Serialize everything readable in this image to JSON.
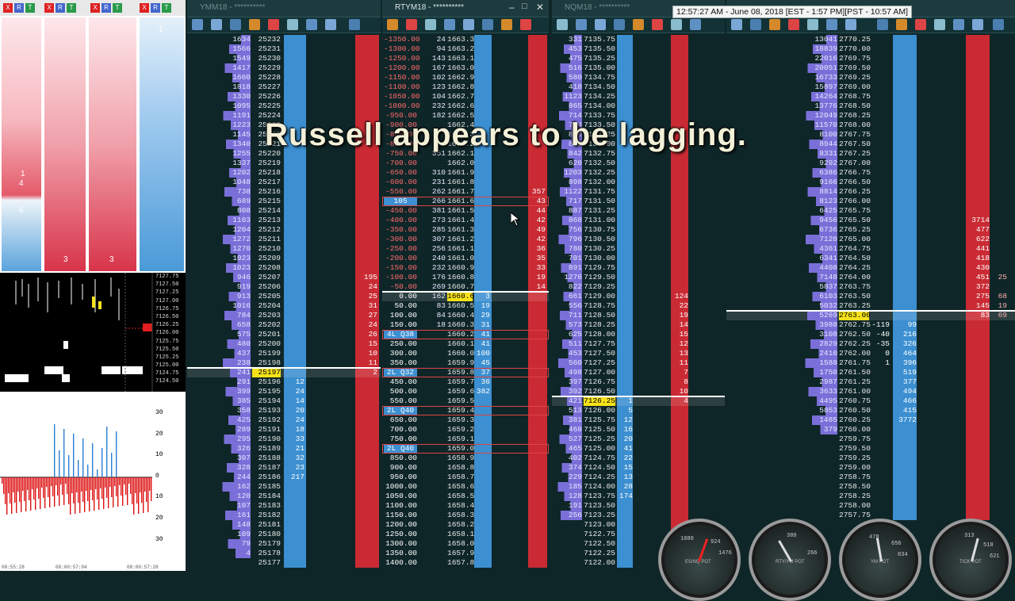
{
  "windows": {
    "ym_title": "YMM18 - **********",
    "rty_title": "RTYM18 - **********",
    "nq_title": "NQM18 - **********",
    "es_title": ""
  },
  "clock": "12:57:27 AM - June 08, 2018 [EST - 1:57 PM][PST - 10:57 AM]",
  "overlay": "Russell appears to be lagging.",
  "left": {
    "ladder_labels": [
      "1",
      "4",
      "6",
      "3",
      "3",
      "1"
    ],
    "price_axis": [
      "7127.75",
      "7127.50",
      "7127.25",
      "7127.00",
      "7126.75",
      "7126.50",
      "7126.25",
      "7126.00",
      "7125.75",
      "7125.50",
      "7125.25",
      "7125.00",
      "7124.75",
      "7124.50"
    ],
    "hist_axis": [
      "30",
      "20",
      "10",
      "0",
      "10",
      "20",
      "30"
    ],
    "time_axis": [
      "08:55:28",
      "08:00:57:04",
      "08:00:57:28"
    ],
    "top_btn_labels": [
      "X",
      "R",
      "T",
      "X",
      "R",
      "T",
      "X",
      "R",
      "T",
      "X",
      "R",
      "T"
    ]
  },
  "ym": {
    "vol": [
      "1634",
      "1566",
      "1549",
      "1417",
      "1660",
      "1818",
      "1330",
      "1095",
      "1191",
      "1223",
      "1145",
      "1340",
      "1255",
      "1337",
      "1202",
      "1048",
      "738",
      "689",
      "808",
      "1103",
      "1204",
      "1272",
      "1270",
      "1023",
      "1023",
      "946",
      "919",
      "913",
      "1016",
      "784",
      "658",
      "575",
      "480",
      "437",
      "238",
      "241",
      "291",
      "399",
      "385",
      "358",
      "425",
      "289",
      "295",
      "326",
      "307",
      "328",
      "244",
      "162",
      "120",
      "107",
      "161",
      "148",
      "109",
      "79",
      "4",
      ""
    ],
    "price": [
      "25232",
      "25231",
      "25230",
      "25229",
      "25228",
      "25227",
      "25226",
      "25225",
      "25224",
      "25223",
      "25222",
      "25221",
      "25220",
      "25219",
      "25218",
      "25217",
      "25216",
      "25215",
      "25214",
      "25213",
      "25212",
      "25211",
      "25210",
      "25209",
      "25208",
      "25207",
      "25206",
      "25205",
      "25204",
      "25203",
      "25202",
      "25201",
      "25200",
      "25199",
      "25198",
      "25197",
      "25196",
      "25195",
      "25194",
      "25193",
      "25192",
      "25191",
      "25190",
      "25189",
      "25188",
      "25187",
      "25186",
      "25185",
      "25184",
      "25183",
      "25182",
      "25181",
      "25180",
      "25179",
      "25178",
      "25177"
    ],
    "bid": {
      "36": "12",
      "37": "24",
      "38": "14",
      "39": "20",
      "40": "24",
      "41": "18",
      "42": "33",
      "43": "21",
      "44": "32",
      "45": "23",
      "46": "217"
    },
    "ask": {
      "25": "195",
      "26": "24",
      "27": "25",
      "28": "31",
      "29": "27",
      "30": "24",
      "31": "26",
      "32": "15",
      "33": "10",
      "34": "11",
      "35": "2"
    },
    "last_index": 35,
    "side_nums": {
      "4": "4",
      "10": "10",
      "1": "1",
      "5": "5"
    }
  },
  "rty": {
    "offset": [
      "-1350.00",
      "-1300.00",
      "-1250.00",
      "-1200.00",
      "-1150.00",
      "-1100.00",
      "-1050.00",
      "-1000.00",
      "-950.00",
      "-900.00",
      "-850.00",
      "-800.00",
      "-750.00",
      "-700.00",
      "-650.00",
      "-600.00",
      "-550.00",
      "-500.00",
      "-450.00",
      "-400.00",
      "-350.00",
      "-300.00",
      "-250.00",
      "-200.00",
      "-150.00",
      "-100.00",
      "-50.00",
      "0.00",
      "50.00",
      "100.00",
      "150.00",
      "200.00",
      "250.00",
      "300.00",
      "350.00",
      "400.00",
      "450.00",
      "500.00",
      "550.00",
      "600.00",
      "650.00",
      "700.00",
      "750.00",
      "800.00",
      "850.00",
      "900.00",
      "950.00",
      "1000.00",
      "1050.00",
      "1100.00",
      "1150.00",
      "1200.00",
      "1250.00",
      "1300.00",
      "1350.00",
      "1400.00"
    ],
    "vol": [
      "24",
      "94",
      "143",
      "167",
      "102",
      "123",
      "104",
      "232",
      "182",
      "",
      "",
      "",
      "351",
      "",
      "310",
      "231",
      "262",
      "266",
      "381",
      "273",
      "285",
      "307",
      "256",
      "240",
      "232",
      "176",
      "269",
      "162",
      "83",
      "84",
      "18",
      "",
      "",
      "",
      "",
      "",
      "",
      "",
      "",
      "",
      "",
      "",
      "",
      "",
      "",
      "",
      "",
      "",
      "",
      "",
      "",
      "",
      "",
      "",
      "",
      ""
    ],
    "price": [
      "1663.3",
      "1663.2",
      "1663.1",
      "1663.0",
      "1662.9",
      "1662.8",
      "1662.7",
      "1662.6",
      "1662.5",
      "1662.4",
      "1662.3",
      "1662.2",
      "1662.1",
      "1662.0",
      "1661.9",
      "1661.8",
      "1661.7",
      "1661.6",
      "1661.5",
      "1661.4",
      "1661.3",
      "1661.2",
      "1661.1",
      "1661.0",
      "1660.9",
      "1660.8",
      "1660.7",
      "1660.6",
      "1660.5",
      "1660.4",
      "1660.3",
      "1660.2",
      "1660.1",
      "1660.0",
      "1659.9",
      "1659.8",
      "1659.7",
      "1659.6",
      "1659.5",
      "1659.4",
      "1659.3",
      "1659.2",
      "1659.1",
      "1659.0",
      "1658.9",
      "1658.8",
      "1658.7",
      "1658.6",
      "1658.5",
      "1658.4",
      "1658.3",
      "1658.2",
      "1658.1",
      "1658.0",
      "1657.9",
      "1657.8"
    ],
    "bid": {
      "27": "3",
      "28": "19",
      "29": "29",
      "30": "31",
      "31": "41",
      "32": "41",
      "33": "100",
      "34": "45",
      "35": "37",
      "36": "36",
      "37": "382"
    },
    "ask": {
      "16": "357",
      "17": "43",
      "18": "44",
      "19": "42",
      "20": "49",
      "21": "42",
      "22": "36",
      "23": "35",
      "24": "33",
      "25": "19",
      "26": "14"
    },
    "last_index": 27,
    "tags": {
      "17": "105",
      "31": "4L Q38",
      "35": "2L Q32",
      "39": "2L Q40",
      "43": "2L Q40"
    }
  },
  "nq": {
    "vol": [
      "331",
      "453",
      "475",
      "516",
      "580",
      "418",
      "1123",
      "865",
      "714",
      "734",
      "849",
      "888",
      "842",
      "620",
      "1203",
      "898",
      "1122",
      "717",
      "887",
      "868",
      "756",
      "796",
      "780",
      "701",
      "891",
      "1276",
      "822",
      "661",
      "556",
      "711",
      "573",
      "625",
      "511",
      "453",
      "560",
      "498",
      "397",
      "392",
      "421",
      "513",
      "381",
      "468",
      "527",
      "465",
      "402",
      "374",
      "229",
      "185",
      "128",
      "191",
      "256"
    ],
    "price": [
      "7135.75",
      "7135.50",
      "7135.25",
      "7135.00",
      "7134.75",
      "7134.50",
      "7134.25",
      "7134.00",
      "7133.75",
      "7133.50",
      "7133.25",
      "7133.00",
      "7132.75",
      "7132.50",
      "7132.25",
      "7132.00",
      "7131.75",
      "7131.50",
      "7131.25",
      "7131.00",
      "7130.75",
      "7130.50",
      "7130.25",
      "7130.00",
      "7129.75",
      "7129.50",
      "7129.25",
      "7129.00",
      "7128.75",
      "7128.50",
      "7128.25",
      "7128.00",
      "7127.75",
      "7127.50",
      "7127.25",
      "7127.00",
      "7126.75",
      "7126.50",
      "7126.25",
      "7126.00",
      "7125.75",
      "7125.50",
      "7125.25",
      "7125.00",
      "7124.75",
      "7124.50",
      "7124.25",
      "7124.00",
      "7123.75",
      "7123.50",
      "7123.25",
      "7123.00",
      "7122.75",
      "7122.50",
      "7122.25",
      "7122.00"
    ],
    "bid": {
      "38": "1",
      "39": "5",
      "40": "12",
      "41": "16",
      "42": "20",
      "43": "41",
      "44": "22",
      "45": "15",
      "46": "13",
      "47": "28",
      "48": "174"
    },
    "ask": {
      "27": "124",
      "28": "22",
      "29": "19",
      "30": "14",
      "31": "15",
      "32": "12",
      "33": "13",
      "34": "11",
      "35": "7",
      "36": "8",
      "37": "10",
      "38": "4"
    },
    "last_index": 38,
    "side_nums": {
      "3": "3"
    }
  },
  "es": {
    "vol": [
      "13041",
      "18839",
      "22016",
      "20051",
      "16733",
      "15897",
      "14264",
      "13776",
      "12049",
      "11570",
      "8100",
      "8944",
      "8331",
      "9292",
      "6386",
      "9166",
      "8814",
      "8123",
      "6425",
      "9456",
      "6736",
      "7120",
      "4361",
      "6341",
      "4408",
      "7148",
      "5837",
      "6103",
      "5032",
      "5269",
      "3988",
      "3108",
      "2829",
      "2410",
      "1588",
      "1750",
      "2987",
      "3633",
      "4495",
      "5853",
      "1485",
      "379",
      "",
      "",
      "",
      "",
      "",
      "",
      "",
      "",
      ""
    ],
    "price": [
      "2770.25",
      "2770.00",
      "2769.75",
      "2769.50",
      "2769.25",
      "2769.00",
      "2768.75",
      "2768.50",
      "2768.25",
      "2768.00",
      "2767.75",
      "2767.50",
      "2767.25",
      "2767.00",
      "2766.75",
      "2766.50",
      "2766.25",
      "2766.00",
      "2765.75",
      "2765.50",
      "2765.25",
      "2765.00",
      "2764.75",
      "2764.50",
      "2764.25",
      "2764.00",
      "2763.75",
      "2763.50",
      "2763.25",
      "2763.00",
      "2762.75",
      "2762.50",
      "2762.25",
      "2762.00",
      "2761.75",
      "2761.50",
      "2761.25",
      "2761.00",
      "2760.75",
      "2760.50",
      "2760.25",
      "2760.00",
      "2759.75",
      "2759.50",
      "2759.25",
      "2759.00",
      "2758.75",
      "2758.50",
      "2758.25",
      "2758.00",
      "2757.75"
    ],
    "bid": {
      "30": "99",
      "31": "216",
      "32": "326",
      "33": "464",
      "34": "396",
      "35": "519",
      "36": "377",
      "37": "494",
      "38": "466",
      "39": "415",
      "40": "3772"
    },
    "bidneg": {
      "30": "-119",
      "31": "-40",
      "32": "-35",
      "33": "0",
      "34": "1"
    },
    "ask": {
      "19": "3714",
      "20": "477",
      "21": "622",
      "22": "441",
      "23": "418",
      "24": "430",
      "25": "451",
      "26": "372",
      "27": "275",
      "28": "145",
      "29": "83"
    },
    "ask2": {
      "25": "25",
      "27": "68",
      "28": "19",
      "29": "69"
    },
    "last_index": 29,
    "side_nums": {
      "30": "2",
      "29": "2"
    }
  },
  "gauges": [
    {
      "label": "ES/NQ POT",
      "nums": [
        "1080",
        "924",
        "1476"
      ]
    },
    {
      "label": "RTY/YM POT",
      "nums": [
        "380",
        "266"
      ]
    },
    {
      "label": "YM POT",
      "nums": [
        "478",
        "656",
        "834"
      ]
    },
    {
      "label": "TICK POT",
      "nums": [
        "313",
        "518",
        "621"
      ]
    }
  ],
  "colors": {
    "bg": "#0f2628",
    "bid": "#3c8fd0",
    "ask": "#ca2a33",
    "vol": "#2a3b7a",
    "last": "#f7e21a"
  }
}
